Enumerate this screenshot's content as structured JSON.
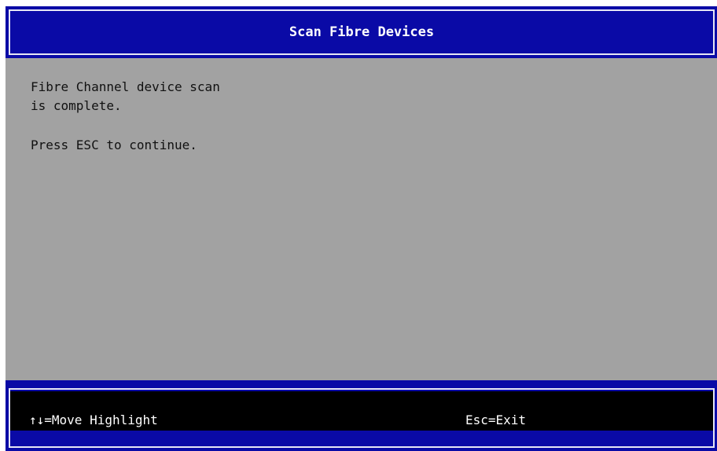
{
  "screen": {
    "title": "Scan Fibre Devices"
  },
  "message": {
    "line1": "Fibre Channel device scan",
    "line2": "is complete.",
    "line3": "Press ESC to continue."
  },
  "footer": {
    "move_hint": "↑↓=Move Highlight",
    "exit_hint": "Esc=Exit"
  },
  "colors": {
    "title_bar": "#0a0aa6",
    "background": "#a2a2a2",
    "footer_bg": "#000000",
    "text": "#111111"
  }
}
